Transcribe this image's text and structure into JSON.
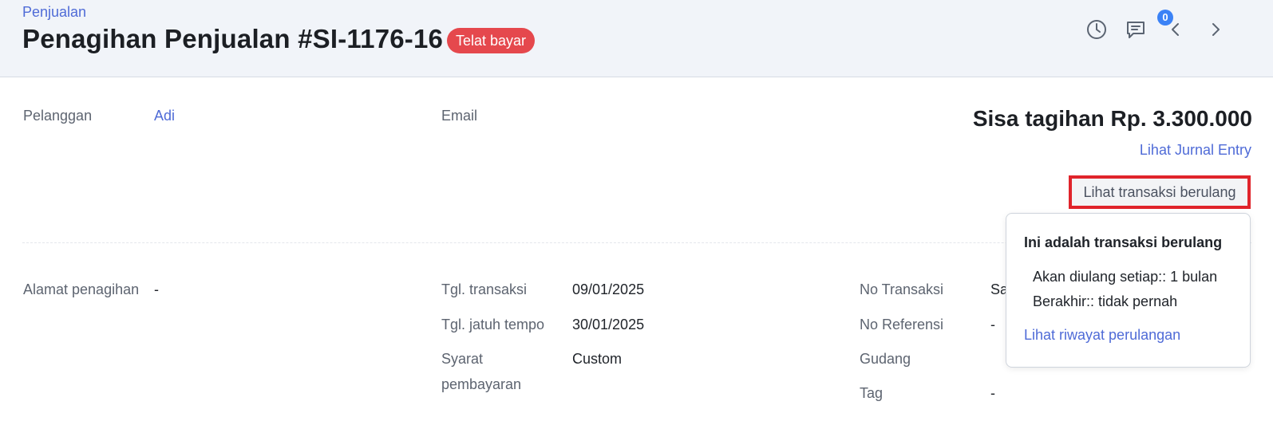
{
  "header": {
    "breadcrumb": "Penjualan",
    "title": "Penagihan Penjualan #SI-1176-16",
    "status_badge": "Telat bayar",
    "notification_count": "0"
  },
  "customer": {
    "label": "Pelanggan",
    "value": "Adi"
  },
  "email": {
    "label": "Email"
  },
  "balance": {
    "text": "Sisa tagihan Rp. 3.300.000",
    "journal_link": "Lihat Jurnal Entry",
    "recurring_button": "Lihat transaksi berulang"
  },
  "address": {
    "label": "Alamat penagihan",
    "value": "-"
  },
  "details_mid": {
    "trans_date_label": "Tgl. transaksi",
    "trans_date_value": "09/01/2025",
    "due_date_label": "Tgl. jatuh tempo",
    "due_date_value": "30/01/2025",
    "terms_label_1": "Syarat",
    "terms_label_2": "pembayaran",
    "terms_value": "Custom"
  },
  "details_right": {
    "no_trans_label": "No Transaksi",
    "no_trans_value": "Sa",
    "no_ref_label": "No Referensi",
    "no_ref_value": "-",
    "warehouse_label": "Gudang",
    "tag_label": "Tag",
    "tag_value": "-"
  },
  "popover": {
    "title": "Ini adalah transaksi berulang",
    "repeat_line": "Akan diulang setiap:: 1 bulan",
    "end_line": "Berakhir:: tidak pernah",
    "history_link": "Lihat riwayat perulangan"
  },
  "colors": {
    "accent": "#4f6bd7",
    "badge": "#e5484d",
    "highlight": "#e0242b",
    "notification": "#3b82f6"
  }
}
